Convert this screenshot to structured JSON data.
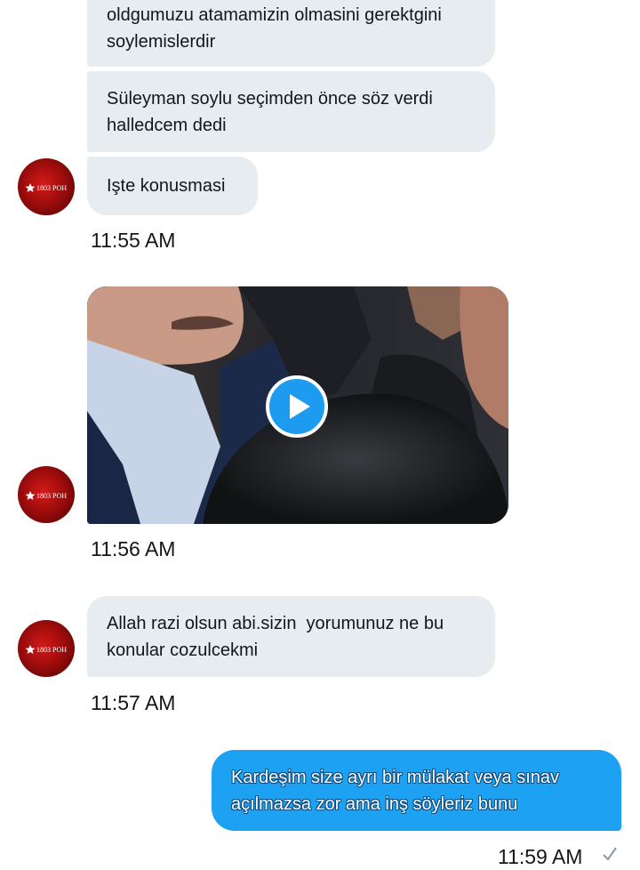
{
  "messages": {
    "m1": {
      "line1": "oldgumuzu atamamizin olmasini gerektgini",
      "line2": "soylemislerdir"
    },
    "m2": {
      "line1": "Süleyman soylu seçimden önce söz verdi",
      "line2": "halledcem dedi"
    },
    "m3": {
      "text": "Işte konusmasi"
    },
    "m3_time": "11:55 AM",
    "video_time": "11:56 AM",
    "m4": {
      "line1": "Allah razi olsun abi.sizin  yorumunuz ne bu",
      "line2": "konular cozulcekmi"
    },
    "m4_time": "11:57 AM",
    "outgoing": {
      "line1": "Kardeşim size ayrı bir mülakat veya sınav",
      "line2": "açılmazsa zor ama inş söyleriz bunu"
    },
    "outgoing_time": "11:59 AM"
  },
  "avatar": {
    "text": "1803 POH"
  },
  "icons": {
    "play": "play-icon",
    "read_receipt": "checkmark-icon",
    "avatar_star": "star-icon"
  },
  "colors": {
    "incoming_bubble": "#e6ecf0",
    "outgoing_bubble": "#1da1f2",
    "accent": "#1d9bf0",
    "avatar_red": "#c41414"
  }
}
